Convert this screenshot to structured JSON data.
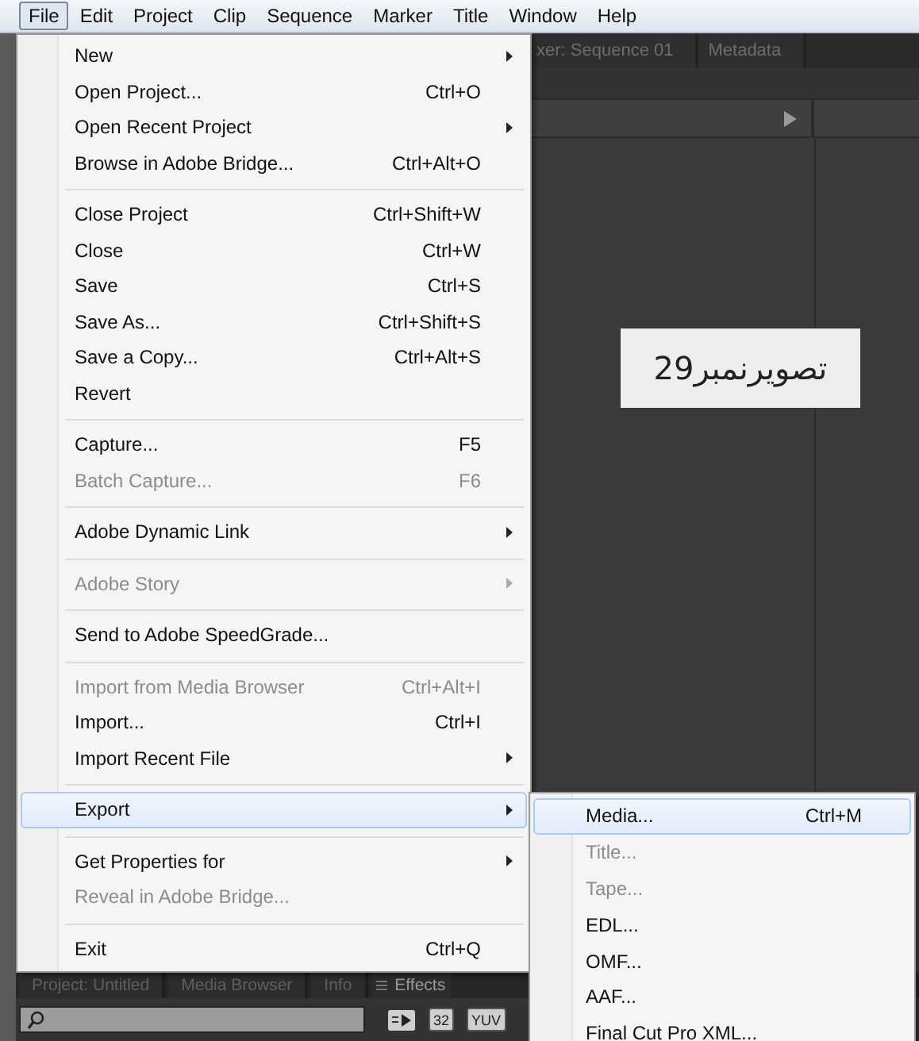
{
  "menu_bar": [
    {
      "label": "File",
      "selected": true
    },
    {
      "label": "Edit",
      "selected": false
    },
    {
      "label": "Project",
      "selected": false
    },
    {
      "label": "Clip",
      "selected": false
    },
    {
      "label": "Sequence",
      "selected": false
    },
    {
      "label": "Marker",
      "selected": false
    },
    {
      "label": "Title",
      "selected": false
    },
    {
      "label": "Window",
      "selected": false
    },
    {
      "label": "Help",
      "selected": false
    }
  ],
  "top_tabs": [
    "xer: Sequence 01",
    "Metadata"
  ],
  "caption": "تصویرنمبر29",
  "file_menu": [
    {
      "kind": "item",
      "label": "New",
      "submenu": true,
      "disabled": false,
      "selected": false
    },
    {
      "kind": "item",
      "label": "Open Project...",
      "shortcut": "Ctrl+O",
      "submenu": false,
      "disabled": false,
      "selected": false
    },
    {
      "kind": "item",
      "label": "Open Recent Project",
      "submenu": true,
      "disabled": false,
      "selected": false
    },
    {
      "kind": "item",
      "label": "Browse in Adobe Bridge...",
      "shortcut": "Ctrl+Alt+O",
      "submenu": false,
      "disabled": false,
      "selected": false
    },
    {
      "kind": "separator"
    },
    {
      "kind": "item",
      "label": "Close Project",
      "shortcut": "Ctrl+Shift+W",
      "submenu": false,
      "disabled": false,
      "selected": false
    },
    {
      "kind": "item",
      "label": "Close",
      "shortcut": "Ctrl+W",
      "submenu": false,
      "disabled": false,
      "selected": false
    },
    {
      "kind": "item",
      "label": "Save",
      "shortcut": "Ctrl+S",
      "submenu": false,
      "disabled": false,
      "selected": false
    },
    {
      "kind": "item",
      "label": "Save As...",
      "shortcut": "Ctrl+Shift+S",
      "submenu": false,
      "disabled": false,
      "selected": false
    },
    {
      "kind": "item",
      "label": "Save a Copy...",
      "shortcut": "Ctrl+Alt+S",
      "submenu": false,
      "disabled": false,
      "selected": false
    },
    {
      "kind": "item",
      "label": "Revert",
      "submenu": false,
      "disabled": false,
      "selected": false
    },
    {
      "kind": "separator"
    },
    {
      "kind": "item",
      "label": "Capture...",
      "shortcut": "F5",
      "submenu": false,
      "disabled": false,
      "selected": false
    },
    {
      "kind": "item",
      "label": "Batch Capture...",
      "shortcut": "F6",
      "submenu": false,
      "disabled": true,
      "selected": false
    },
    {
      "kind": "separator"
    },
    {
      "kind": "item",
      "label": "Adobe Dynamic Link",
      "submenu": true,
      "disabled": false,
      "selected": false
    },
    {
      "kind": "separator"
    },
    {
      "kind": "item",
      "label": "Adobe Story",
      "submenu": true,
      "disabled": true,
      "selected": false
    },
    {
      "kind": "separator"
    },
    {
      "kind": "item",
      "label": "Send to Adobe SpeedGrade...",
      "submenu": false,
      "disabled": false,
      "selected": false
    },
    {
      "kind": "separator"
    },
    {
      "kind": "item",
      "label": "Import from Media Browser",
      "shortcut": "Ctrl+Alt+I",
      "submenu": false,
      "disabled": true,
      "selected": false
    },
    {
      "kind": "item",
      "label": "Import...",
      "shortcut": "Ctrl+I",
      "submenu": false,
      "disabled": false,
      "selected": false
    },
    {
      "kind": "item",
      "label": "Import Recent File",
      "submenu": true,
      "disabled": false,
      "selected": false
    },
    {
      "kind": "separator"
    },
    {
      "kind": "item",
      "label": "Export",
      "submenu": true,
      "disabled": false,
      "selected": true
    },
    {
      "kind": "separator"
    },
    {
      "kind": "item",
      "label": "Get Properties for",
      "submenu": true,
      "disabled": false,
      "selected": false
    },
    {
      "kind": "item",
      "label": "Reveal in Adobe Bridge...",
      "submenu": false,
      "disabled": true,
      "selected": false
    },
    {
      "kind": "separator"
    },
    {
      "kind": "item",
      "label": "Exit",
      "shortcut": "Ctrl+Q",
      "submenu": false,
      "disabled": false,
      "selected": false
    }
  ],
  "export_submenu": [
    {
      "label": "Media...",
      "shortcut": "Ctrl+M",
      "disabled": false,
      "selected": true
    },
    {
      "label": "Title...",
      "disabled": true,
      "selected": false
    },
    {
      "label": "Tape...",
      "disabled": true,
      "selected": false
    },
    {
      "label": "EDL...",
      "disabled": false,
      "selected": false
    },
    {
      "label": "OMF...",
      "disabled": false,
      "selected": false
    },
    {
      "label": "AAF...",
      "disabled": false,
      "selected": false
    },
    {
      "label": "Final Cut Pro XML...",
      "disabled": false,
      "selected": false
    }
  ],
  "bottom_tabs": [
    {
      "label": "Project: Untitled",
      "kind": "plain"
    },
    {
      "label": "Media Browser",
      "kind": "plain"
    },
    {
      "label": "Info",
      "kind": "plain"
    },
    {
      "label": "Effects",
      "kind": "menu"
    }
  ],
  "bottom_toolbar": {
    "badges": [
      "32",
      "YUV"
    ]
  }
}
